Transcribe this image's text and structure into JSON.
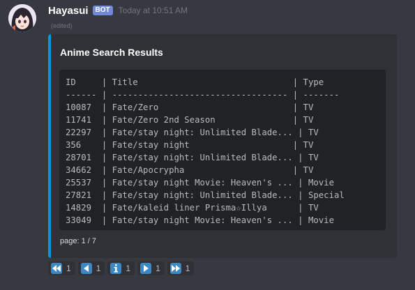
{
  "message": {
    "username": "Hayasui",
    "bot_tag": "BOT",
    "timestamp": "Today at 10:51 AM",
    "edited": "(edited)"
  },
  "embed": {
    "title": "Anime Search Results",
    "accent_color": "#0099e1",
    "table_lines": [
      "ID     | Title                              | Type",
      "------ | ---------------------------------- | -------",
      "10087  | Fate/Zero                          | TV",
      "11741  | Fate/Zero 2nd Season               | TV",
      "22297  | Fate/stay night: Unlimited Blade... | TV",
      "356    | Fate/stay night                    | TV",
      "28701  | Fate/stay night: Unlimited Blade... | TV",
      "34662  | Fate/Apocrypha                     | TV",
      "25537  | Fate/stay night Movie: Heaven's ... | Movie",
      "27821  | Fate/stay night: Unlimited Blade... | Special",
      "14829  | Fate/kaleid liner Prisma☆Illya      | TV",
      "33049  | Fate/stay night Movie: Heaven's ... | Movie"
    ],
    "footer": "page: 1 / 7"
  },
  "reactions": [
    {
      "icon": "rewind-icon",
      "count": "1"
    },
    {
      "icon": "previous-icon",
      "count": "1"
    },
    {
      "icon": "info-icon",
      "count": "1"
    },
    {
      "icon": "next-icon",
      "count": "1"
    },
    {
      "icon": "fast-forward-icon",
      "count": "1"
    }
  ]
}
